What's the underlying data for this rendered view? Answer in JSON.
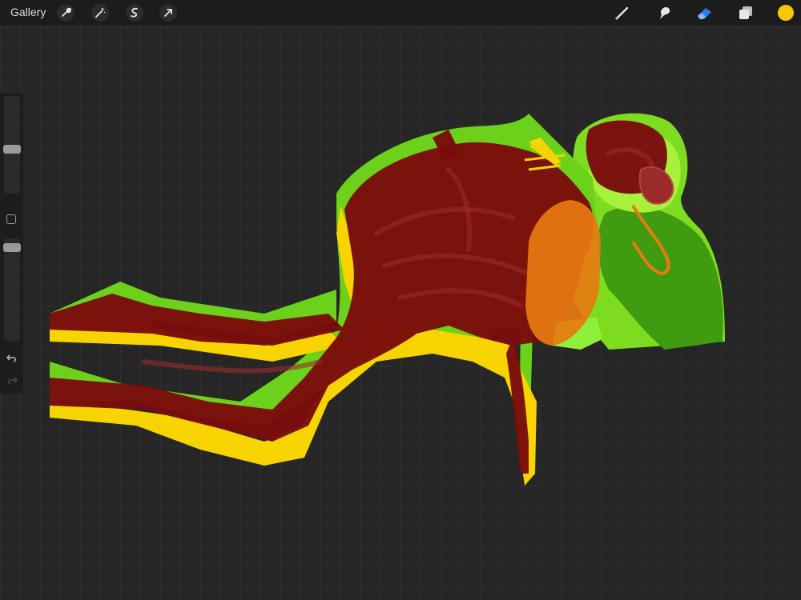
{
  "topbar": {
    "gallery_label": "Gallery",
    "left_tools": [
      "wrench-icon",
      "magic-wand-icon",
      "selection-icon",
      "transform-arrow-icon"
    ],
    "right_tools": [
      "brush-icon",
      "smudge-icon",
      "eraser-icon",
      "layers-icon"
    ],
    "active_tool": "eraser-icon",
    "active_tool_color": "#2f7cf6",
    "current_color": "#f7c800"
  },
  "sidebar": {
    "brush_size_level": 0.45,
    "opacity_level": 0.95,
    "controls": [
      "modify-button",
      "undo-icon",
      "redo-icon"
    ]
  },
  "artwork": {
    "palette": [
      "#7ddc1f",
      "#f7d400",
      "#7a0c0c",
      "#e87a10",
      "#4caf1a",
      "#a8f03a"
    ]
  }
}
